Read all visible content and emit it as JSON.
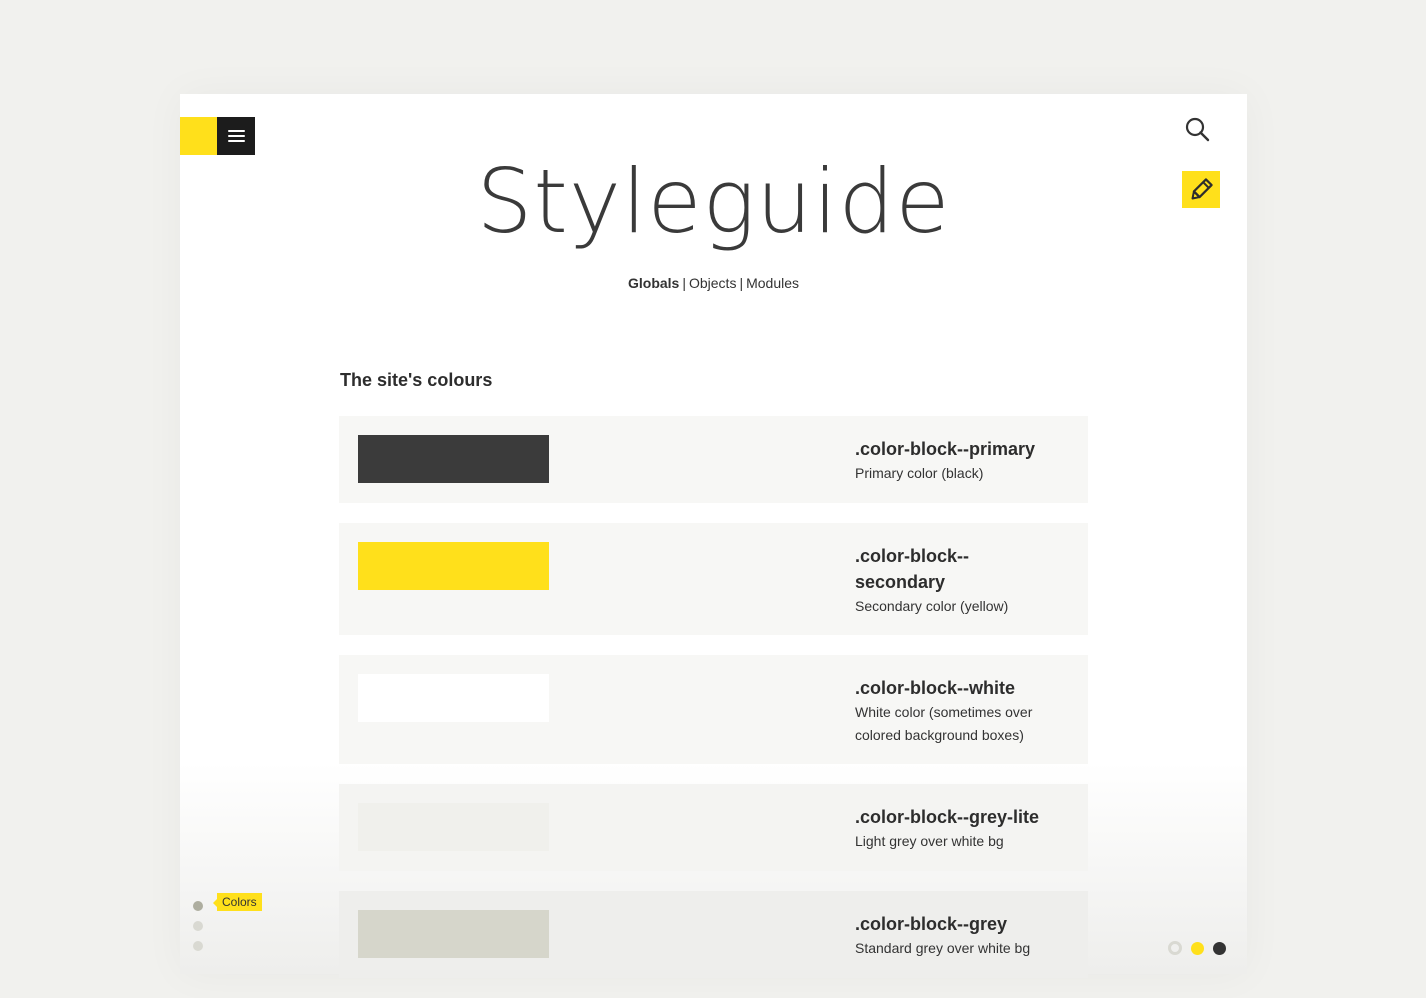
{
  "header": {
    "title": "Styleguide",
    "menu_icon": "hamburger-icon",
    "search_icon": "search-icon",
    "edit_icon": "pencil-icon"
  },
  "subnav": {
    "items": [
      {
        "label": "Globals",
        "active": true
      },
      {
        "label": "Objects",
        "active": false
      },
      {
        "label": "Modules",
        "active": false
      }
    ],
    "separator": "|"
  },
  "section": {
    "title": "The site's colours"
  },
  "swatches": [
    {
      "name": ".color-block--primary",
      "description": "Primary color (black)",
      "color": "#3b3b3b"
    },
    {
      "name": ".color-block--secondary",
      "description": "Secondary color (yellow)",
      "color": "#ffe01b"
    },
    {
      "name": ".color-block--white",
      "description": "White color (sometimes over colored background boxes)",
      "color": "#ffffff"
    },
    {
      "name": ".color-block--grey-lite",
      "description": "Light grey over white bg",
      "color": "#f0f0ec"
    },
    {
      "name": ".color-block--grey",
      "description": "Standard grey over white bg",
      "color": "#d6d6cb"
    }
  ],
  "scroll_nav": {
    "tooltip": "Colors",
    "dots": 3,
    "active_index": 0
  },
  "theme_switcher": {
    "options": [
      "grey",
      "yellow",
      "black"
    ]
  },
  "colors": {
    "accent": "#ffe01b",
    "dark": "#1c1c1c",
    "background": "#f1f1ee"
  }
}
